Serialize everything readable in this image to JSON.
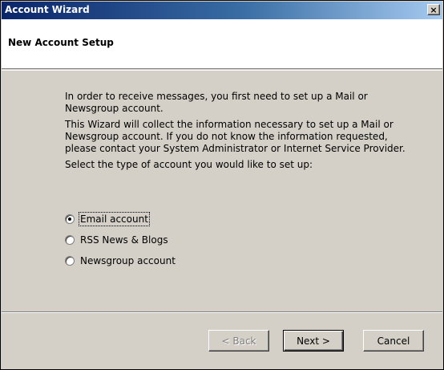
{
  "window": {
    "title": "Account Wizard",
    "close_glyph": "×"
  },
  "header": {
    "title": "New Account Setup"
  },
  "content": {
    "para1": "In order to receive messages, you first need to set up a Mail or Newsgroup account.",
    "para2": "This Wizard will collect the information necessary to set up a Mail or Newsgroup account. If you do not know the information requested, please contact your System Administrator or Internet Service Provider.",
    "para3": "Select the type of account you would like to set up:"
  },
  "options": [
    {
      "label": "Email account",
      "checked": true
    },
    {
      "label": "RSS News & Blogs",
      "checked": false
    },
    {
      "label": "Newsgroup account",
      "checked": false
    }
  ],
  "buttons": {
    "back": "< Back",
    "next": "Next >",
    "cancel": "Cancel"
  }
}
